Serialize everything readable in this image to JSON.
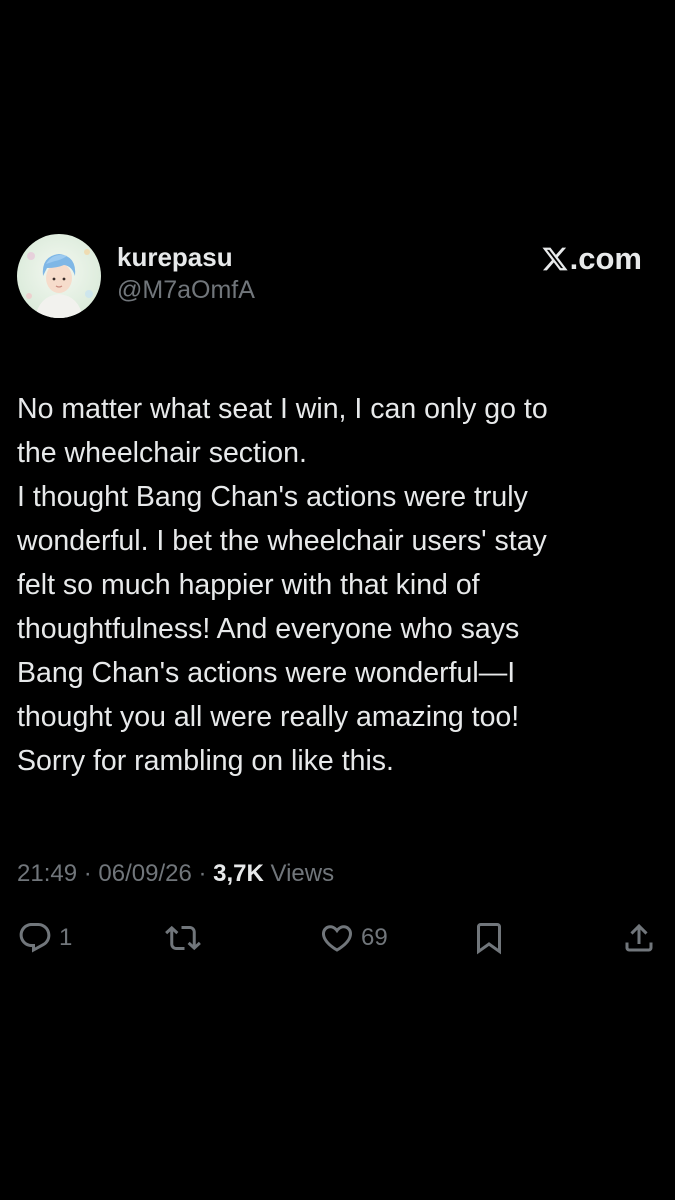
{
  "post": {
    "author": {
      "display_name": "kurepasu",
      "handle": "@M7aOmfA"
    },
    "brand": {
      "label": ".com",
      "logo_icon": "x-logo-icon"
    },
    "text_lines": [
      "No matter what seat I win, I can only go to",
      "the wheelchair section.",
      "I thought Bang Chan's actions were truly",
      "wonderful. I bet the wheelchair users' stay",
      "felt so much happier with that kind of",
      "thoughtfulness! And everyone who says",
      "Bang Chan's actions were wonderful—I",
      "thought you all were really amazing too!",
      "Sorry for rambling on like this."
    ],
    "meta": {
      "time": "21:49",
      "separator": " · ",
      "date": "06/09/26",
      "views_count": "3,7K",
      "views_label": " Views"
    },
    "actions": {
      "reply": {
        "icon": "reply-icon",
        "count": "1"
      },
      "repost": {
        "icon": "repost-icon"
      },
      "like": {
        "icon": "heart-icon",
        "count": "69"
      },
      "bookmark": {
        "icon": "bookmark-icon"
      },
      "share": {
        "icon": "share-icon"
      }
    }
  },
  "colors": {
    "background": "#000000",
    "primary_text": "#e7e9ea",
    "secondary_text": "#71767b"
  }
}
